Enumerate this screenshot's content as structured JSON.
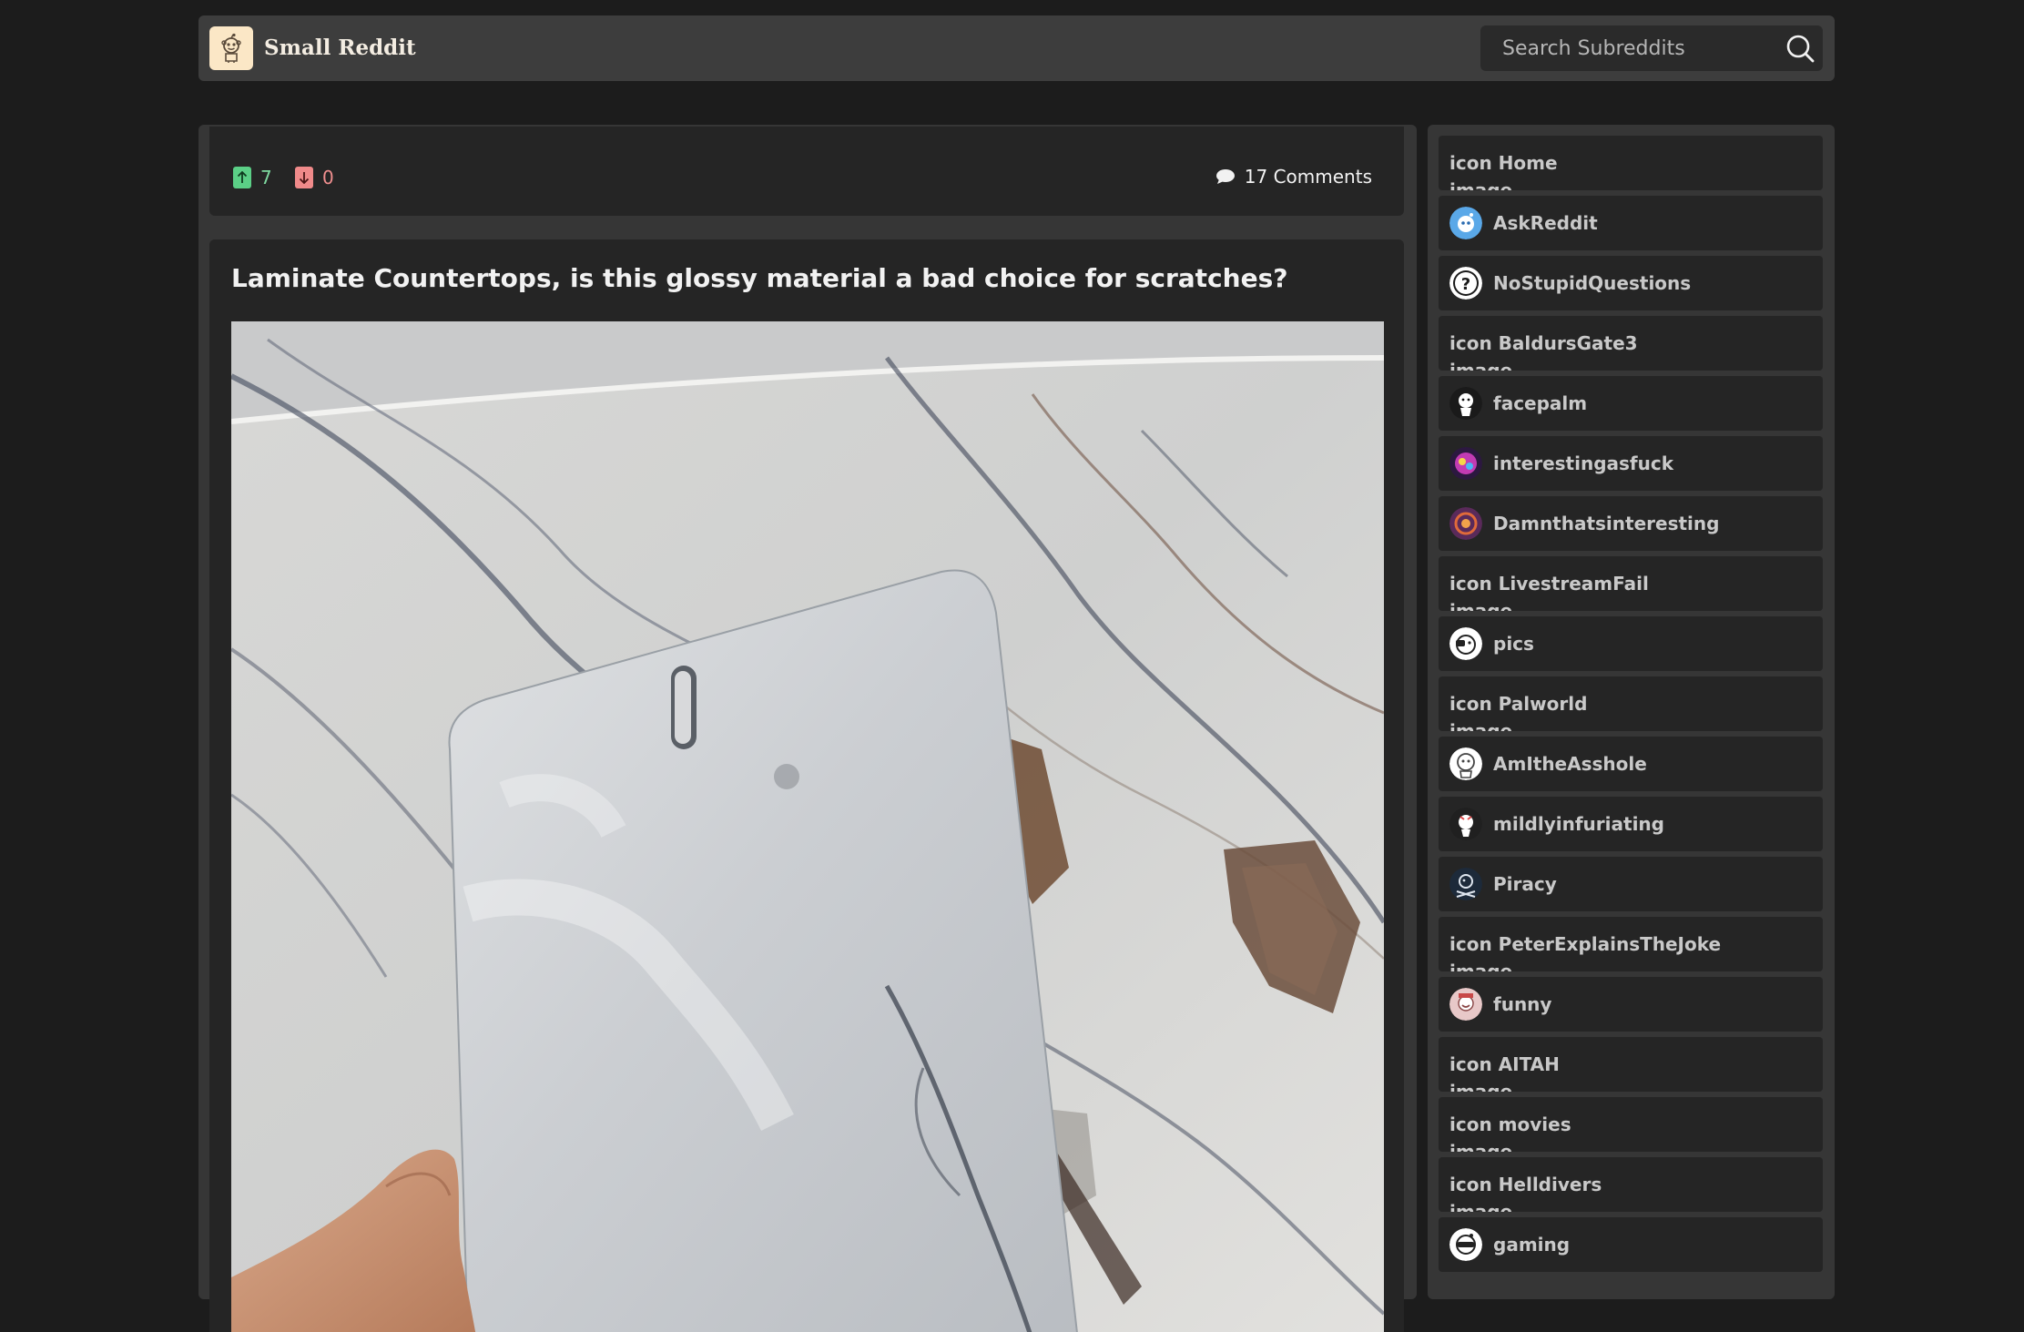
{
  "header": {
    "brand": "Small Reddit",
    "search_placeholder": "Search Subreddits",
    "logo_icon": "reddit-snoo-icon",
    "search_icon": "search-icon"
  },
  "post": {
    "upvotes": "7",
    "downvotes": "0",
    "comments": "17 Comments",
    "title": "Laminate Countertops, is this glossy material a bad choice for scratches?",
    "image_subject": "marble-laminate-sample-photo"
  },
  "sidebar": {
    "items": [
      {
        "name": "Home",
        "alt_prefix": "icon",
        "alt_suffix": "image",
        "broken": true
      },
      {
        "name": "AskReddit",
        "icon": "askreddit-avatar-icon",
        "color": "#5aa8e8"
      },
      {
        "name": "NoStupidQuestions",
        "icon": "question-mark-icon",
        "color": "#ffffff"
      },
      {
        "name": "BaldursGate3",
        "alt_prefix": "icon",
        "alt_suffix": "image",
        "broken": true
      },
      {
        "name": "facepalm",
        "icon": "facepalm-avatar-icon",
        "color": "#1a1a1a"
      },
      {
        "name": "interestingasfuck",
        "icon": "interestingasfuck-avatar-icon",
        "color": "#c23bb3"
      },
      {
        "name": "Damnthatsinteresting",
        "icon": "damnthatsinteresting-avatar-icon",
        "color": "#5a2a5a"
      },
      {
        "name": "LivestreamFail",
        "alt_prefix": "icon",
        "alt_suffix": "image",
        "broken": true
      },
      {
        "name": "pics",
        "icon": "pics-avatar-icon",
        "color": "#ffffff"
      },
      {
        "name": "Palworld",
        "alt_prefix": "icon",
        "alt_suffix": "image",
        "broken": true
      },
      {
        "name": "AmItheAsshole",
        "icon": "amitheasshole-avatar-icon",
        "color": "#ffffff"
      },
      {
        "name": "mildlyinfuriating",
        "icon": "mildlyinfuriating-avatar-icon",
        "color": "#202020"
      },
      {
        "name": "Piracy",
        "icon": "piracy-skull-icon",
        "color": "#1d2a3a"
      },
      {
        "name": "PeterExplainsTheJoke",
        "alt_prefix": "icon",
        "alt_suffix": "image",
        "broken": true
      },
      {
        "name": "funny",
        "icon": "funny-avatar-icon",
        "color": "#e8c8c8"
      },
      {
        "name": "AITAH",
        "alt_prefix": "icon",
        "alt_suffix": "image",
        "broken": true
      },
      {
        "name": "movies",
        "alt_prefix": "icon",
        "alt_suffix": "image",
        "broken": true
      },
      {
        "name": "Helldivers",
        "alt_prefix": "icon",
        "alt_suffix": "image",
        "broken": true
      },
      {
        "name": "gaming",
        "icon": "gaming-avatar-icon",
        "color": "#ffffff"
      }
    ]
  }
}
